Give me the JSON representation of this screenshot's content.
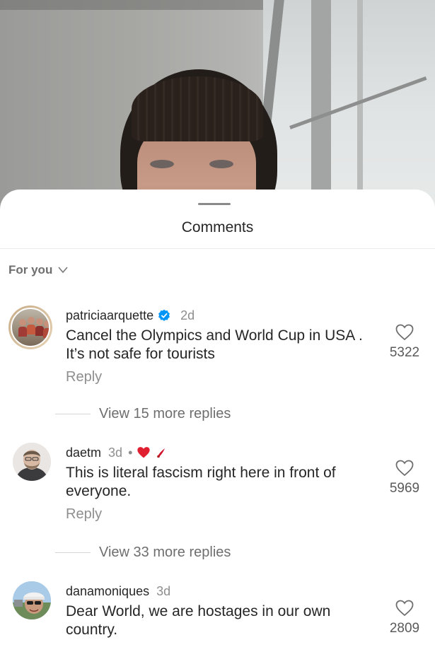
{
  "video": {},
  "sheet": {
    "title": "Comments",
    "sort_label": "For you"
  },
  "comments": [
    {
      "username": "patriciaarquette",
      "verified": true,
      "time": "2d",
      "text": "Cancel the Olympics and World Cup in USA . It’s not safe for tourists",
      "reply_label": "Reply",
      "view_replies": "View 15 more replies",
      "likes": "5322"
    },
    {
      "username": "daetm",
      "time": "3d",
      "separator": "•",
      "text": "This is literal fascism right here in front of everyone.",
      "reply_label": "Reply",
      "view_replies": "View 33 more replies",
      "likes": "5969",
      "emoji_icons": [
        "red-heart-icon",
        "nail-polish-icon"
      ]
    },
    {
      "username": "danamoniques",
      "time": "3d",
      "text": "Dear World, we are hostages in our own country.",
      "likes": "2809"
    }
  ],
  "colors": {
    "text": "#262626",
    "muted": "#8e8e8e",
    "verified": "#0095f6",
    "heart": "#e0245e"
  }
}
